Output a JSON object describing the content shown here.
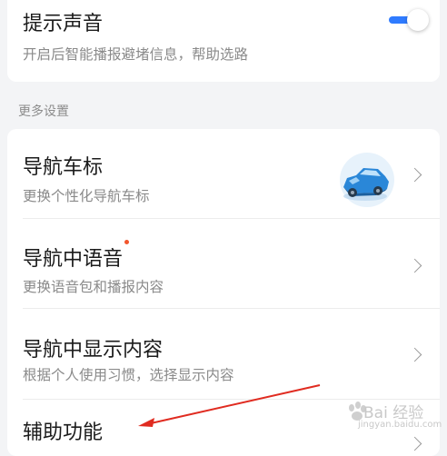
{
  "prompt_sound": {
    "title": "提示声音",
    "subtitle": "开启后智能播报避堵信息，帮助选路",
    "toggle_on": true
  },
  "section": {
    "label": "更多设置"
  },
  "items": [
    {
      "title": "导航车标",
      "subtitle": "更换个性化导航车标",
      "icon": "car-icon"
    },
    {
      "title": "导航中语音",
      "subtitle": "更换语音包和播报内容",
      "badge": "red-dot"
    },
    {
      "title": "导航中显示内容",
      "subtitle": "根据个人使用习惯，选择显示内容"
    },
    {
      "title": "辅助功能"
    }
  ],
  "annotation": {
    "type": "arrow",
    "color": "#e02b20",
    "points_to": "辅助功能"
  },
  "watermark": {
    "text": "Bai 经验",
    "url": "jingyan.baidu.com"
  },
  "colors": {
    "accent": "#2f7bff",
    "badge": "#f2552c",
    "car": "#2a87d8"
  }
}
